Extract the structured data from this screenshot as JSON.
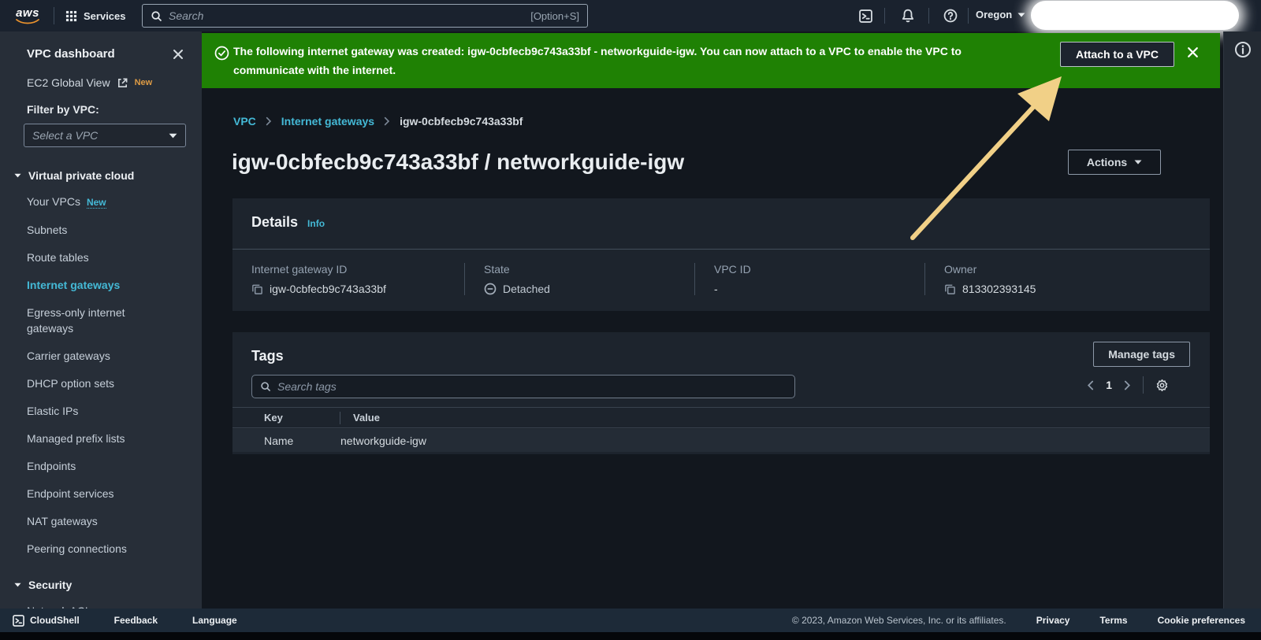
{
  "colors": {
    "banner_green": "#1f8104",
    "link_teal": "#44b9d6",
    "badge_orange": "#dd9b45",
    "arrow_yellow": "#f1d087"
  },
  "topnav": {
    "logo": "aws",
    "services": "Services",
    "search_placeholder": "Search",
    "search_shortcut": "[Option+S]",
    "region": "Oregon"
  },
  "banner": {
    "message": "The following internet gateway was created: igw-0cbfecb9c743a33bf - networkguide-igw. You can now attach to a VPC to enable the VPC to communicate with the internet.",
    "attach_button": "Attach to a VPC"
  },
  "sidebar": {
    "title": "VPC dashboard",
    "ec2_link": "EC2 Global View",
    "ec2_badge": "New",
    "filter_label": "Filter by VPC:",
    "filter_placeholder": "Select a VPC",
    "sections": [
      {
        "header": "Virtual private cloud",
        "items": [
          {
            "label": "Your VPCs",
            "badge": "New"
          },
          {
            "label": "Subnets"
          },
          {
            "label": "Route tables"
          },
          {
            "label": "Internet gateways",
            "active": true
          },
          {
            "label": "Egress-only internet gateways"
          },
          {
            "label": "Carrier gateways"
          },
          {
            "label": "DHCP option sets"
          },
          {
            "label": "Elastic IPs"
          },
          {
            "label": "Managed prefix lists"
          },
          {
            "label": "Endpoints"
          },
          {
            "label": "Endpoint services"
          },
          {
            "label": "NAT gateways"
          },
          {
            "label": "Peering connections"
          }
        ]
      },
      {
        "header": "Security",
        "items": [
          {
            "label": "Network ACLs"
          }
        ]
      }
    ]
  },
  "breadcrumb": {
    "items": [
      "VPC",
      "Internet gateways",
      "igw-0cbfecb9c743a33bf"
    ]
  },
  "page": {
    "title": "igw-0cbfecb9c743a33bf / networkguide-igw",
    "actions_button": "Actions"
  },
  "details": {
    "header": "Details",
    "info_link": "Info",
    "fields": [
      {
        "label": "Internet gateway ID",
        "value": "igw-0cbfecb9c743a33bf"
      },
      {
        "label": "State",
        "value": "Detached"
      },
      {
        "label": "VPC ID",
        "value": "-"
      },
      {
        "label": "Owner",
        "value": "813302393145"
      }
    ]
  },
  "tags": {
    "header": "Tags",
    "manage_button": "Manage tags",
    "search_placeholder": "Search tags",
    "page_number": "1",
    "table": {
      "headers": [
        "Key",
        "Value"
      ],
      "rows": [
        [
          "Name",
          "networkguide-igw"
        ]
      ]
    }
  },
  "footer": {
    "cloudshell": "CloudShell",
    "feedback": "Feedback",
    "language": "Language",
    "copyright": "© 2023, Amazon Web Services, Inc. or its affiliates.",
    "links": [
      "Privacy",
      "Terms",
      "Cookie preferences"
    ]
  }
}
